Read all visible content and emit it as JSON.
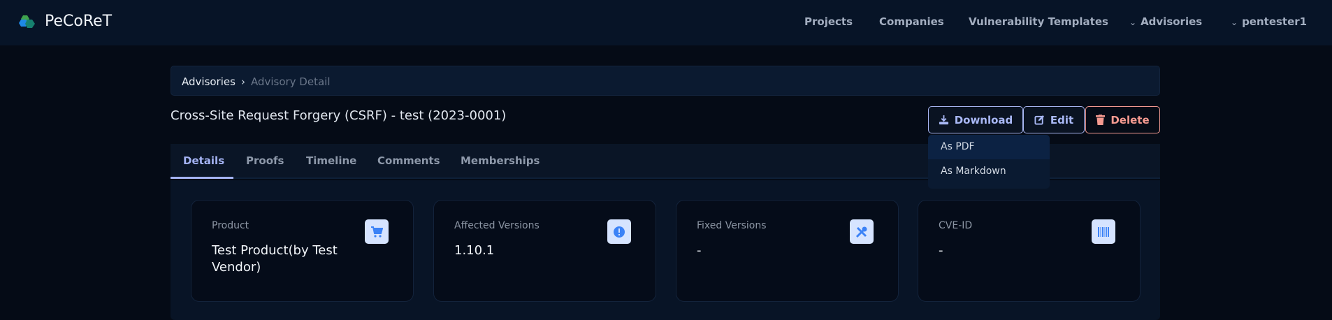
{
  "app": {
    "name": "PeCoReT"
  },
  "nav": {
    "items": [
      "Projects",
      "Companies",
      "Vulnerability Templates"
    ],
    "advisories": "Advisories",
    "user": "pentester1"
  },
  "breadcrumb": {
    "parent": "Advisories",
    "current": "Advisory Detail"
  },
  "page": {
    "title": "Cross-Site Request Forgery (CSRF) - test (2023-0001)"
  },
  "actions": {
    "download": "Download",
    "edit": "Edit",
    "delete": "Delete"
  },
  "download_menu": [
    "As PDF",
    "As Markdown"
  ],
  "tabs": [
    "Details",
    "Proofs",
    "Timeline",
    "Comments",
    "Memberships"
  ],
  "cards": [
    {
      "label": "Product",
      "value": "Test Product(by Test Vendor)",
      "icon": "cart-icon"
    },
    {
      "label": "Affected Versions",
      "value": "1.10.1",
      "icon": "exclamation-icon"
    },
    {
      "label": "Fixed Versions",
      "value": "-",
      "icon": "tools-icon"
    },
    {
      "label": "CVE-ID",
      "value": "-",
      "icon": "barcode-icon"
    }
  ],
  "colors": {
    "accent": "#a4b3f3",
    "danger": "#f59a90",
    "icon": "#3b82f6"
  }
}
